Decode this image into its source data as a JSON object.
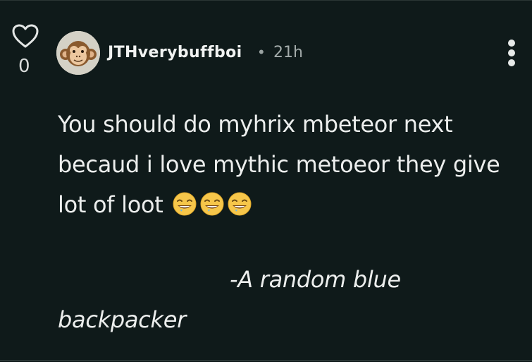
{
  "vote": {
    "count": "0",
    "icon": "heart-outline-icon"
  },
  "post": {
    "author": "JTHverybuffboi",
    "separator": "•",
    "time": "21h",
    "avatar_icon": "monkey-face-icon",
    "menu_icon": "more-vertical-icon"
  },
  "body": {
    "line1": "You should do myhrix mbeteor next",
    "line2": "becaud i love mythic metoeor they give",
    "line3": "lot of loot",
    "emoji_icon": "drooling-grin-emoji",
    "emoji_count": 3,
    "signature_line1": "-A random blue",
    "signature_line2": "backpacker"
  },
  "colors": {
    "background": "#0f1a1a",
    "text": "#eceeed",
    "muted": "#a4acab"
  }
}
